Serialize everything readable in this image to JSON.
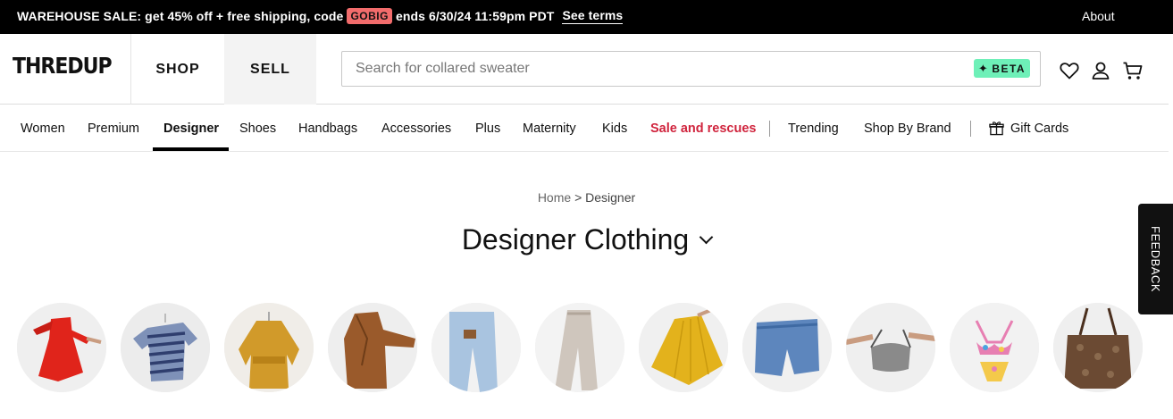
{
  "promo": {
    "text_before": "WAREHOUSE SALE: get 45% off + free shipping, code",
    "code": "GOBIG",
    "text_after": "ends 6/30/24 11:59pm PDT",
    "terms_link": "See terms",
    "about_link": "About",
    "code_color": "#f26c6c"
  },
  "header": {
    "logo": "THREDUP",
    "tabs": [
      {
        "label": "SHOP",
        "active": true
      },
      {
        "label": "SELL",
        "active": false
      }
    ],
    "search": {
      "placeholder": "Search for collared sweater",
      "value": "",
      "badge": "BETA",
      "badge_icon": "sparkle-icon",
      "badge_color": "#6ef0b8"
    },
    "icons": [
      "heart-icon",
      "user-icon",
      "cart-icon"
    ]
  },
  "category_nav": {
    "items": [
      {
        "label": "Women"
      },
      {
        "label": "Premium"
      },
      {
        "label": "Designer",
        "active": true
      },
      {
        "label": "Shoes"
      },
      {
        "label": "Handbags"
      },
      {
        "label": "Accessories"
      },
      {
        "label": "Plus"
      },
      {
        "label": "Maternity"
      },
      {
        "label": "Kids"
      },
      {
        "label": "Sale and rescues",
        "highlight_color": "#d0243d"
      },
      {
        "label": "Trending"
      },
      {
        "label": "Shop By Brand"
      },
      {
        "label": "Gift Cards",
        "icon": "gift-icon"
      }
    ]
  },
  "breadcrumb": {
    "home": "Home",
    "separator": ">",
    "current": "Designer"
  },
  "page": {
    "title": "Designer Clothing",
    "title_icon": "chevron-down-icon"
  },
  "feedback_tab": "FEEDBACK",
  "category_circles": [
    {
      "name": "red-dress",
      "color": "#e0241b"
    },
    {
      "name": "striped-tee",
      "color": "#6b7fa8"
    },
    {
      "name": "mustard-blouse",
      "color": "#d19a2a"
    },
    {
      "name": "brown-blazer",
      "color": "#9a5a2b"
    },
    {
      "name": "light-jeans",
      "color": "#a9c4e0"
    },
    {
      "name": "knit-pants",
      "color": "#cfc6bd"
    },
    {
      "name": "yellow-skirt",
      "color": "#e3b21c"
    },
    {
      "name": "denim-shorts",
      "color": "#5d86bd"
    },
    {
      "name": "gray-bralette",
      "color": "#8a8a8a"
    },
    {
      "name": "floral-bikini",
      "color": "#e77fb2"
    },
    {
      "name": "snakeskin-tote",
      "color": "#6b4a33"
    }
  ]
}
